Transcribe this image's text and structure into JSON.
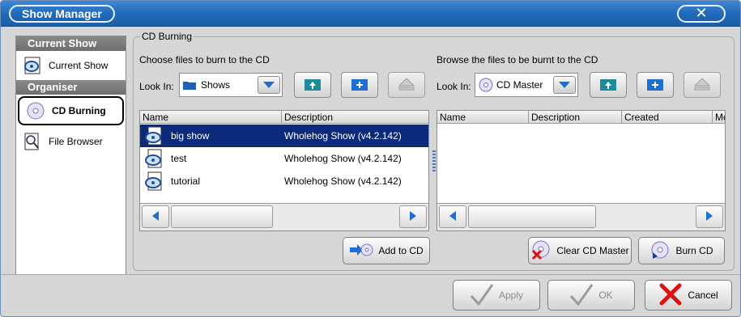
{
  "window": {
    "title": "Show Manager",
    "close_glyph": "✕"
  },
  "sidebar": {
    "sections": [
      {
        "heading": "Current Show",
        "items": [
          {
            "label": "Current Show",
            "icon": "show-disc-icon"
          }
        ]
      },
      {
        "heading": "Organiser",
        "items": [
          {
            "label": "CD Burning",
            "icon": "cd-icon",
            "selected": true
          },
          {
            "label": "File Browser",
            "icon": "magnifier-icon"
          }
        ]
      }
    ]
  },
  "cd_burning": {
    "group_label": "CD Burning",
    "left": {
      "caption": "Choose files to burn to the CD",
      "lookin_label": "Look In:",
      "lookin_value": "Shows",
      "columns": [
        "Name",
        "Description"
      ],
      "rows": [
        {
          "name": "big show",
          "description": "Wholehog Show (v4.2.142)",
          "selected": true
        },
        {
          "name": "test",
          "description": "Wholehog Show (v4.2.142)",
          "selected": false
        },
        {
          "name": "tutorial",
          "description": "Wholehog Show (v4.2.142)",
          "selected": false
        }
      ],
      "add_button": "Add to CD"
    },
    "right": {
      "caption": "Browse the files to be burnt to the CD",
      "lookin_label": "Look In:",
      "lookin_value": "CD Master",
      "columns": [
        "Name",
        "Description",
        "Created",
        "Mo"
      ],
      "clear_button": "Clear CD Master",
      "burn_button": "Burn CD"
    }
  },
  "footer": {
    "apply": "Apply",
    "ok": "OK",
    "cancel": "Cancel"
  },
  "colors": {
    "titlebar": "#2068b8",
    "selection": "#0c2a7a",
    "accent_blue": "#1e6fd1",
    "cancel_red": "#e01010"
  }
}
